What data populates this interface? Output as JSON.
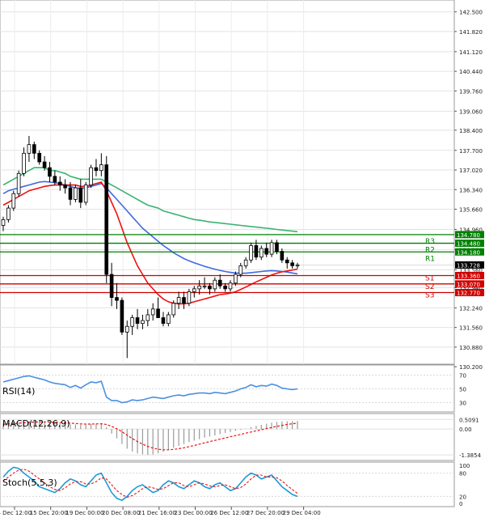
{
  "chart_data": {
    "type": "candlestick",
    "main": {
      "price_range": [
        130.4,
        142.8
      ],
      "y_ticks": [
        "142.500",
        "141.820",
        "141.120",
        "140.440",
        "139.760",
        "139.060",
        "138.400",
        "137.700",
        "137.020",
        "136.340",
        "135.660",
        "134.960",
        "134.260",
        "133.560",
        "132.940",
        "132.240",
        "131.560",
        "130.880",
        "130.200"
      ],
      "x_ticks": [
        "14 Dec 12:00",
        "15 Dec 20:00",
        "19 Dec 00:00",
        "20 Dec 08:00",
        "21 Dec 16:00",
        "23 Dec 00:00",
        "26 Dec 12:00",
        "27 Dec 20:00",
        "29 Dec 04:00"
      ],
      "candles": [
        [
          135.1,
          135.4,
          134.9,
          135.3
        ],
        [
          135.3,
          135.8,
          135.2,
          135.7
        ],
        [
          135.7,
          136.3,
          135.6,
          136.2
        ],
        [
          136.2,
          137.0,
          136.1,
          136.9
        ],
        [
          136.9,
          137.8,
          136.8,
          137.6
        ],
        [
          137.6,
          138.2,
          137.3,
          137.9
        ],
        [
          137.9,
          138.0,
          137.4,
          137.6
        ],
        [
          137.6,
          137.7,
          137.2,
          137.3
        ],
        [
          137.3,
          137.5,
          137.0,
          137.1
        ],
        [
          137.1,
          137.3,
          136.6,
          136.8
        ],
        [
          136.8,
          137.0,
          136.5,
          136.6
        ],
        [
          136.6,
          136.8,
          136.3,
          136.5
        ],
        [
          136.5,
          136.7,
          136.2,
          136.4
        ],
        [
          136.4,
          136.6,
          135.8,
          136.0
        ],
        [
          136.0,
          136.5,
          135.9,
          136.4
        ],
        [
          136.4,
          136.7,
          135.7,
          135.9
        ],
        [
          135.9,
          136.6,
          135.8,
          136.5
        ],
        [
          136.5,
          137.2,
          136.4,
          137.1
        ],
        [
          137.1,
          137.4,
          136.8,
          137.0
        ],
        [
          137.0,
          137.6,
          136.8,
          137.2
        ],
        [
          137.2,
          137.5,
          133.1,
          133.4
        ],
        [
          133.4,
          133.8,
          132.3,
          132.6
        ],
        [
          132.6,
          133.1,
          132.2,
          132.5
        ],
        [
          132.5,
          132.6,
          131.3,
          131.4
        ],
        [
          131.4,
          131.8,
          130.5,
          131.6
        ],
        [
          131.6,
          132.0,
          131.3,
          131.9
        ],
        [
          131.9,
          132.2,
          131.5,
          131.7
        ],
        [
          131.7,
          132.0,
          131.5,
          131.8
        ],
        [
          131.8,
          132.2,
          131.6,
          132.0
        ],
        [
          132.0,
          132.4,
          131.8,
          132.2
        ],
        [
          132.2,
          132.6,
          131.9,
          131.9
        ],
        [
          131.9,
          132.1,
          131.6,
          131.7
        ],
        [
          131.7,
          132.1,
          131.6,
          132.0
        ],
        [
          132.0,
          132.5,
          131.9,
          132.4
        ],
        [
          132.4,
          132.8,
          132.2,
          132.6
        ],
        [
          132.6,
          132.8,
          132.2,
          132.4
        ],
        [
          132.4,
          132.9,
          132.3,
          132.8
        ],
        [
          132.8,
          133.0,
          132.6,
          132.9
        ],
        [
          132.9,
          133.2,
          132.7,
          133.0
        ],
        [
          133.0,
          133.3,
          132.9,
          133.0
        ],
        [
          133.0,
          133.1,
          132.7,
          132.9
        ],
        [
          132.9,
          133.3,
          132.8,
          133.2
        ],
        [
          133.2,
          133.4,
          132.9,
          133.0
        ],
        [
          133.0,
          133.1,
          132.8,
          132.9
        ],
        [
          132.9,
          133.2,
          132.8,
          133.1
        ],
        [
          133.1,
          133.5,
          133.0,
          133.4
        ],
        [
          133.4,
          133.8,
          133.3,
          133.7
        ],
        [
          133.7,
          134.0,
          133.6,
          133.9
        ],
        [
          133.9,
          134.5,
          133.8,
          134.4
        ],
        [
          134.4,
          134.6,
          133.9,
          134.0
        ],
        [
          134.0,
          134.4,
          133.9,
          134.3
        ],
        [
          134.3,
          134.5,
          134.0,
          134.1
        ],
        [
          134.1,
          134.6,
          134.0,
          134.5
        ],
        [
          134.5,
          134.6,
          134.1,
          134.2
        ],
        [
          134.2,
          134.3,
          133.8,
          133.9
        ],
        [
          133.9,
          134.0,
          133.6,
          133.8
        ],
        [
          133.8,
          133.9,
          133.6,
          133.7
        ],
        [
          133.7,
          133.8,
          133.6,
          133.73
        ]
      ],
      "ma_green": [
        136.5,
        136.6,
        136.7,
        136.8,
        136.9,
        137.0,
        137.1,
        137.1,
        137.1,
        137.0,
        137.0,
        136.95,
        136.9,
        136.8,
        136.75,
        136.7,
        136.7,
        136.7,
        136.7,
        136.7,
        136.6,
        136.5,
        136.4,
        136.3,
        136.2,
        136.1,
        136.0,
        135.9,
        135.8,
        135.75,
        135.7,
        135.6,
        135.55,
        135.5,
        135.45,
        135.4,
        135.35,
        135.3,
        135.28,
        135.25,
        135.22,
        135.2,
        135.18,
        135.16,
        135.14,
        135.12,
        135.1,
        135.08,
        135.06,
        135.04,
        135.02,
        135.0,
        134.98,
        134.96,
        134.94,
        134.92,
        134.9,
        134.88
      ],
      "ma_blue": [
        136.2,
        136.3,
        136.35,
        136.4,
        136.45,
        136.5,
        136.55,
        136.6,
        136.62,
        136.6,
        136.58,
        136.55,
        136.5,
        136.45,
        136.4,
        136.38,
        136.4,
        136.45,
        136.5,
        136.55,
        136.4,
        136.2,
        136.0,
        135.8,
        135.6,
        135.4,
        135.2,
        135.0,
        134.85,
        134.7,
        134.55,
        134.4,
        134.28,
        134.15,
        134.05,
        133.95,
        133.87,
        133.8,
        133.74,
        133.68,
        133.63,
        133.58,
        133.54,
        133.5,
        133.47,
        133.45,
        133.44,
        133.44,
        133.46,
        133.48,
        133.5,
        133.52,
        133.53,
        133.52,
        133.5,
        133.48,
        133.45,
        133.42
      ],
      "ma_red": [
        135.8,
        135.9,
        136.0,
        136.1,
        136.2,
        136.3,
        136.35,
        136.4,
        136.45,
        136.48,
        136.5,
        136.5,
        136.5,
        136.5,
        136.5,
        136.45,
        136.45,
        136.5,
        136.55,
        136.6,
        136.3,
        135.9,
        135.5,
        135.0,
        134.5,
        134.1,
        133.7,
        133.4,
        133.1,
        132.9,
        132.7,
        132.55,
        132.45,
        132.4,
        132.38,
        132.38,
        132.4,
        132.45,
        132.5,
        132.55,
        132.6,
        132.65,
        132.7,
        132.72,
        132.75,
        132.8,
        132.88,
        132.96,
        133.05,
        133.14,
        133.22,
        133.3,
        133.38,
        133.44,
        133.49,
        133.52,
        133.55,
        133.58
      ],
      "last_price": "133.728",
      "levels": [
        {
          "name": "R3",
          "value": 134.78,
          "label": "134.780",
          "color": "#008000"
        },
        {
          "name": "R2",
          "value": 134.48,
          "label": "134.480",
          "color": "#008000"
        },
        {
          "name": "R1",
          "value": 134.18,
          "label": "134.180",
          "color": "#008000"
        },
        {
          "name": "S1",
          "value": 133.36,
          "label": "133.360",
          "color": "#d00000"
        },
        {
          "name": "S2",
          "value": 133.07,
          "label": "133.070",
          "color": "#d00000"
        },
        {
          "name": "S3",
          "value": 132.77,
          "label": "132.770",
          "color": "#d00000"
        }
      ]
    },
    "rsi": {
      "label": "RSI(14)",
      "ticks": [
        "70",
        "50",
        "30"
      ],
      "range": [
        20,
        80
      ],
      "values": [
        60,
        62,
        64,
        66,
        68,
        69,
        67,
        65,
        63,
        60,
        58,
        57,
        56,
        52,
        55,
        51,
        56,
        60,
        59,
        61,
        38,
        33,
        33,
        30,
        31,
        34,
        33,
        34,
        36,
        38,
        37,
        36,
        38,
        40,
        41,
        40,
        42,
        43,
        44,
        44,
        43,
        45,
        44,
        43,
        45,
        47,
        50,
        52,
        56,
        53,
        55,
        54,
        57,
        55,
        51,
        50,
        49,
        50
      ]
    },
    "macd": {
      "label": "MACD(12,26,9)",
      "ticks": [
        "0.5091",
        "0.00",
        "-1.3854"
      ],
      "range": [
        -1.55,
        0.65
      ],
      "histogram": [
        0.3,
        0.32,
        0.34,
        0.36,
        0.38,
        0.4,
        0.41,
        0.4,
        0.38,
        0.35,
        0.33,
        0.31,
        0.28,
        0.25,
        0.24,
        0.22,
        0.23,
        0.26,
        0.28,
        0.3,
        0.1,
        -0.25,
        -0.5,
        -0.8,
        -1.05,
        -1.2,
        -1.3,
        -1.35,
        -1.38,
        -1.36,
        -1.3,
        -1.22,
        -1.12,
        -1.0,
        -0.9,
        -0.8,
        -0.7,
        -0.62,
        -0.54,
        -0.46,
        -0.4,
        -0.34,
        -0.28,
        -0.22,
        -0.16,
        -0.1,
        -0.04,
        0.02,
        0.1,
        0.16,
        0.22,
        0.28,
        0.34,
        0.38,
        0.4,
        0.41,
        0.42,
        0.42
      ],
      "signal": [
        0.25,
        0.27,
        0.29,
        0.31,
        0.33,
        0.35,
        0.37,
        0.38,
        0.38,
        0.37,
        0.36,
        0.35,
        0.33,
        0.31,
        0.29,
        0.27,
        0.26,
        0.26,
        0.27,
        0.28,
        0.24,
        0.14,
        0.01,
        -0.15,
        -0.33,
        -0.51,
        -0.67,
        -0.81,
        -0.93,
        -1.02,
        -1.08,
        -1.11,
        -1.11,
        -1.09,
        -1.05,
        -1.0,
        -0.94,
        -0.88,
        -0.81,
        -0.74,
        -0.67,
        -0.61,
        -0.54,
        -0.48,
        -0.41,
        -0.35,
        -0.29,
        -0.22,
        -0.16,
        -0.1,
        -0.04,
        0.02,
        0.08,
        0.14,
        0.19,
        0.24,
        0.28,
        0.31
      ]
    },
    "stoch": {
      "label": "Stoch(5,5,3)",
      "ticks": [
        "100",
        "80",
        "20",
        "0"
      ],
      "range": [
        0,
        100
      ],
      "k": [
        70,
        85,
        95,
        92,
        80,
        70,
        60,
        45,
        40,
        35,
        30,
        40,
        55,
        65,
        60,
        50,
        45,
        60,
        75,
        80,
        55,
        30,
        15,
        10,
        20,
        35,
        45,
        50,
        40,
        30,
        35,
        50,
        60,
        55,
        45,
        40,
        50,
        60,
        55,
        45,
        40,
        50,
        55,
        45,
        35,
        40,
        55,
        70,
        80,
        75,
        65,
        70,
        75,
        60,
        45,
        35,
        25,
        20
      ],
      "d": [
        60,
        70,
        80,
        88,
        90,
        85,
        75,
        65,
        55,
        45,
        38,
        35,
        42,
        52,
        58,
        58,
        52,
        52,
        58,
        68,
        65,
        50,
        35,
        25,
        18,
        22,
        30,
        40,
        45,
        42,
        38,
        40,
        48,
        55,
        55,
        48,
        45,
        50,
        55,
        52,
        47,
        45,
        48,
        50,
        45,
        40,
        43,
        52,
        65,
        75,
        75,
        70,
        70,
        68,
        60,
        48,
        38,
        28
      ]
    }
  }
}
